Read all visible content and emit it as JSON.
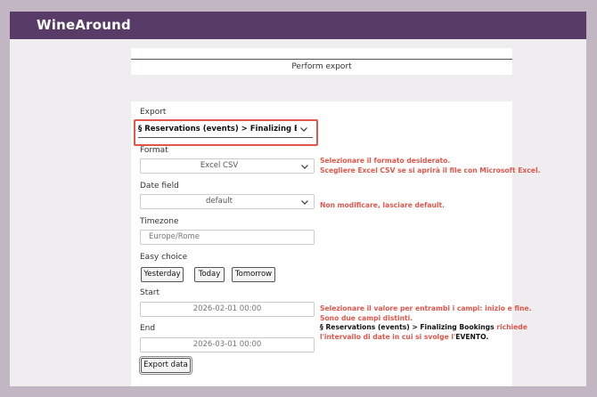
{
  "header": {
    "brand": "WineAround",
    "brand_color": "#583b66"
  },
  "section_title": "Perform export",
  "form": {
    "export": {
      "label": "Export",
      "value": "§ Reservations (events) > Finalizing Booki"
    },
    "format": {
      "label": "Format",
      "value": "Excel CSV"
    },
    "date_field": {
      "label": "Date field",
      "value": "default"
    },
    "timezone": {
      "label": "Timezone",
      "value": "Europe/Rome"
    },
    "easy_choice": {
      "label": "Easy choice",
      "buttons": [
        "Yesterday",
        "Today",
        "Tomorrow"
      ]
    },
    "start": {
      "label": "Start",
      "value": "2026-02-01 00:00"
    },
    "end": {
      "label": "End",
      "value": "2026-03-01 00:00"
    },
    "submit": "Export data"
  },
  "annotations": {
    "color": "#e2564b",
    "format_line1": "Selezionare il formato desiderato.",
    "format_line2": "Scegliere Excel CSV se si aprirà il file con Microsoft Excel.",
    "date_field": "Non modificare, lasciare default.",
    "range_line1": "Selezionare il valore per entrambi i campi: inizio e fine.",
    "range_line2": "Sono due campi distinti.",
    "range_line3_bold": "§ Reservations (events) > Finalizing Bookings",
    "range_line3_rest": " richiede",
    "range_line4_pre": "l'intervallo di date in cui si svolge l'",
    "range_line4_bold": "EVENTO."
  }
}
